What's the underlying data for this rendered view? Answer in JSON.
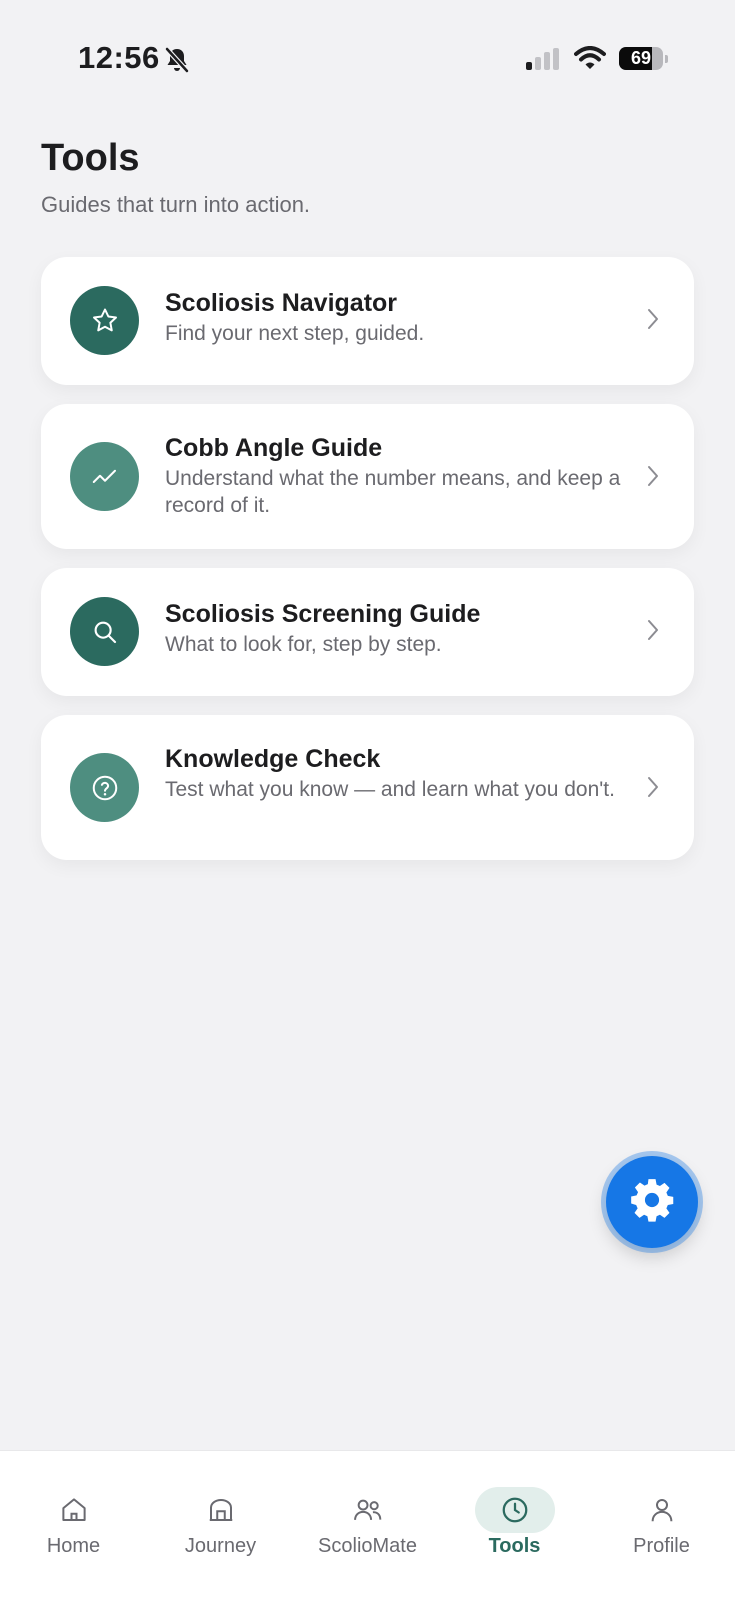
{
  "status_bar": {
    "time": "12:56",
    "battery_level": "69",
    "icons": [
      "bell-off-icon",
      "cellular-signal-icon",
      "wifi-icon",
      "battery-icon"
    ]
  },
  "header": {
    "title": "Tools",
    "subtitle": "Guides that turn into action."
  },
  "tools": [
    {
      "title": "Scoliosis Navigator",
      "description": "Find your next step, guided.",
      "icon": "star-icon",
      "color": "#2b6a5f"
    },
    {
      "title": "Cobb Angle Guide",
      "description": "Understand what the number means, and keep a record of it.",
      "icon": "trend-line-icon",
      "color": "#4e8e80"
    },
    {
      "title": "Scoliosis Screening Guide",
      "description": "What to look for, step by step.",
      "icon": "search-icon",
      "color": "#2b6a5f"
    },
    {
      "title": "Knowledge Check",
      "description": "Test what you know — and learn what you don't.",
      "icon": "question-circle-icon",
      "color": "#4e8e80"
    }
  ],
  "fab": {
    "icon": "gear-icon",
    "color": "#1677e6"
  },
  "tab_bar": {
    "active": "Tools",
    "accent_color": "#2b6a5f",
    "tabs": [
      {
        "label": "Home",
        "icon": "home-icon"
      },
      {
        "label": "Journey",
        "icon": "arch-icon"
      },
      {
        "label": "ScolioMate",
        "icon": "people-icon"
      },
      {
        "label": "Tools",
        "icon": "clock-icon"
      },
      {
        "label": "Profile",
        "icon": "person-icon"
      }
    ]
  }
}
